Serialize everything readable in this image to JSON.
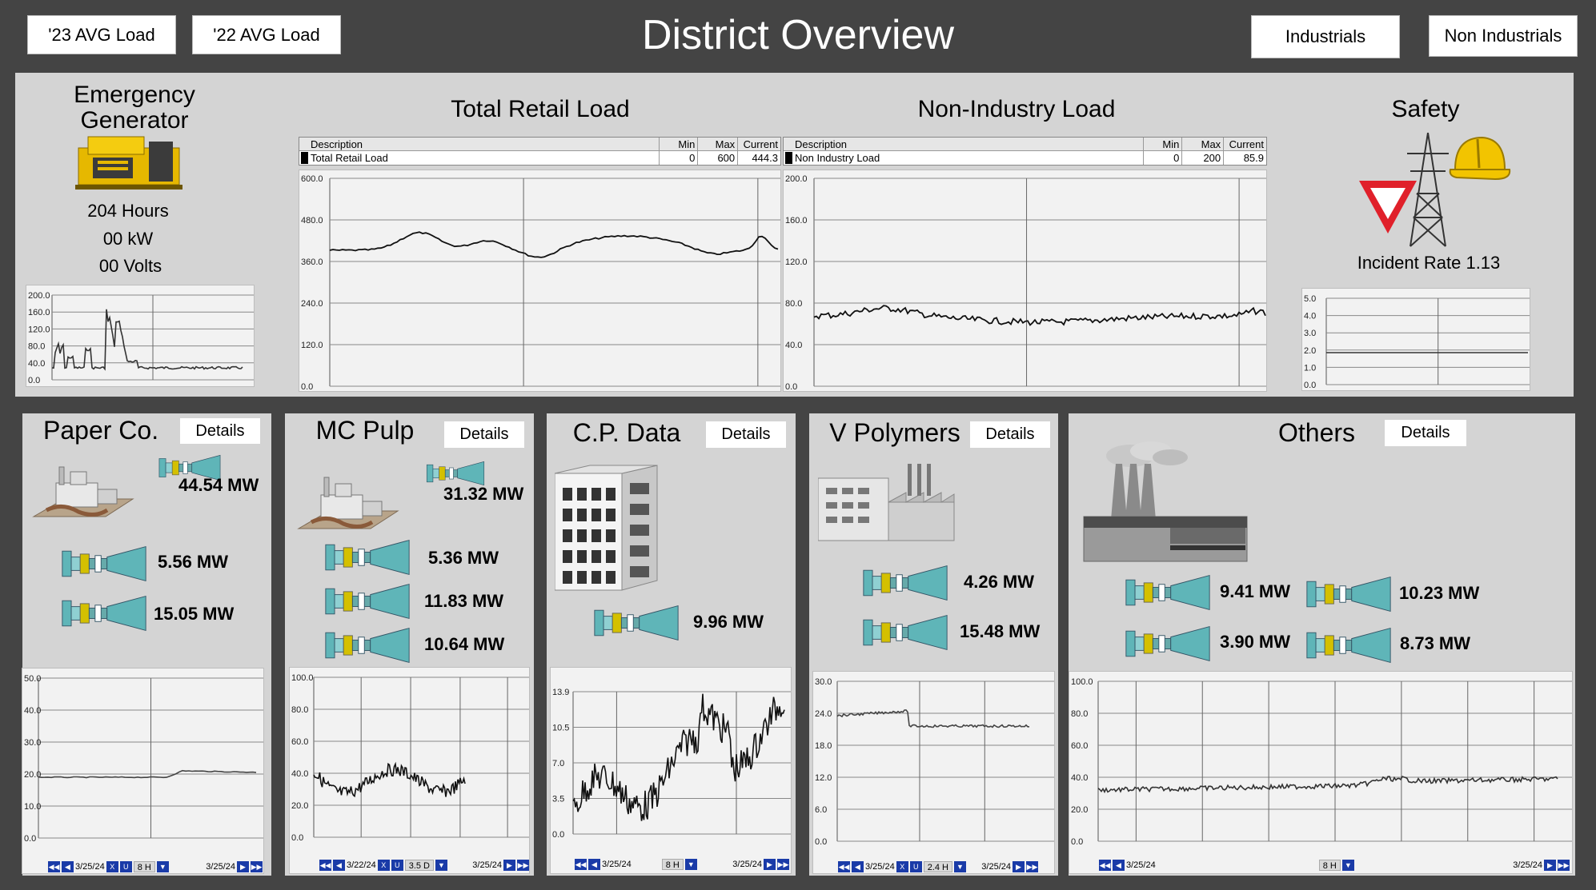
{
  "header": {
    "title": "District Overview",
    "btn_23": "'23 AVG Load",
    "btn_22": "'22 AVG Load",
    "btn_ind": "Industrials",
    "btn_nonind": "Non Industrials"
  },
  "generator": {
    "title_line1": "Emergency",
    "title_line2": "Generator",
    "hours": "204 Hours",
    "kw": "00 kW",
    "volts": "00 Volts",
    "y_ticks": [
      "200.0",
      "160.0",
      "120.0",
      "80.0",
      "40.0",
      "0.0"
    ]
  },
  "retail": {
    "title": "Total Retail Load",
    "hdr_desc": "Description",
    "hdr_min": "Min",
    "hdr_max": "Max",
    "hdr_cur": "Current",
    "desc": "Total Retail Load",
    "min": "0",
    "max": "600",
    "current": "444.3",
    "y_ticks": [
      "600.0",
      "480.0",
      "360.0",
      "240.0",
      "120.0",
      "0.0"
    ]
  },
  "nonind": {
    "title": "Non-Industry Load",
    "hdr_desc": "Description",
    "hdr_min": "Min",
    "hdr_max": "Max",
    "hdr_cur": "Current",
    "desc": "Non Industry Load",
    "min": "0",
    "max": "200",
    "current": "85.9",
    "y_ticks": [
      "200.0",
      "160.0",
      "120.0",
      "80.0",
      "40.0",
      "0.0"
    ]
  },
  "safety": {
    "title": "Safety",
    "incident": "Incident Rate 1.13",
    "y_ticks": [
      "5.0",
      "4.0",
      "3.0",
      "2.0",
      "1.0",
      "0.0"
    ]
  },
  "units": {
    "paper": {
      "name": "Paper Co.",
      "details": "Details",
      "mw": [
        "44.54 MW",
        "5.56 MW",
        "15.05 MW"
      ],
      "y_ticks": [
        "50.0",
        "40.0",
        "30.0",
        "20.0",
        "10.0",
        "0.0"
      ],
      "nav_date_left": "3/25/24",
      "nav_range": "8 H",
      "nav_date_right": "3/25/24"
    },
    "pulp": {
      "name": "MC Pulp",
      "details": "Details",
      "mw": [
        "31.32 MW",
        "5.36 MW",
        "11.83 MW",
        "10.64 MW"
      ],
      "y_ticks": [
        "100.0",
        "80.0",
        "60.0",
        "40.0",
        "20.0",
        "0.0"
      ],
      "nav_date_left": "3/22/24",
      "nav_range": "3.5 D",
      "nav_date_right": "3/25/24"
    },
    "cp": {
      "name": "C.P. Data",
      "details": "Details",
      "mw": [
        "9.96 MW"
      ],
      "y_ticks": [
        "13.9",
        "10.5",
        "7.0",
        "3.5",
        "0.0"
      ],
      "nav_date_left": "3/25/24",
      "nav_range": "8 H",
      "nav_date_right": "3/25/24"
    },
    "poly": {
      "name": "V Polymers",
      "details": "Details",
      "mw": [
        "4.26 MW",
        "15.48 MW"
      ],
      "y_ticks": [
        "30.0",
        "24.0",
        "18.0",
        "12.0",
        "6.0",
        "0.0"
      ],
      "nav_date_left": "3/25/24",
      "nav_range": "2.4 H",
      "nav_date_right": "3/25/24"
    },
    "others": {
      "name": "Others",
      "details": "Details",
      "mw": [
        "9.41 MW",
        "10.23 MW",
        "3.90 MW",
        "8.73 MW"
      ],
      "y_ticks": [
        "100.0",
        "80.0",
        "60.0",
        "40.0",
        "20.0",
        "0.0"
      ],
      "nav_date_left": "3/25/24",
      "nav_range": "8 H",
      "nav_date_right": "3/25/24"
    }
  },
  "nav_x": "X",
  "nav_u": "U",
  "icons": {
    "nav_first": "double-left-arrow-icon",
    "nav_prev": "left-arrow-icon",
    "nav_next": "right-arrow-icon",
    "nav_last": "double-right-arrow-icon",
    "nav_drop": "dropdown-icon"
  },
  "colors": {
    "background": "#444444",
    "panel": "#d4d4d4",
    "nav_button": "#1a3ba8",
    "turbine": "#5fb5b8",
    "warning_red": "#e0202a",
    "helmet_yellow": "#f2c400"
  }
}
